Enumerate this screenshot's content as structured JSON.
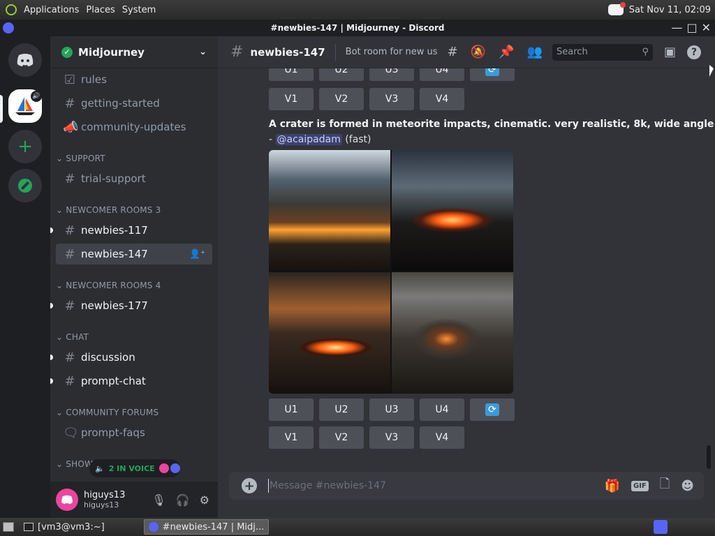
{
  "system_bar": {
    "menus": [
      "Applications",
      "Places",
      "System"
    ],
    "clock": "Sat Nov 11, 02:09"
  },
  "window": {
    "title": "#newbies-147 | Midjourney - Discord"
  },
  "guild": {
    "name": "Midjourney"
  },
  "sidebar": {
    "channels_top": [
      {
        "label": "rules"
      },
      {
        "label": "getting-started"
      },
      {
        "label": "community-updates"
      }
    ],
    "categories": {
      "support": "SUPPORT",
      "newcomer3": "NEWCOMER ROOMS 3",
      "newcomer4": "NEWCOMER ROOMS 4",
      "chat": "CHAT",
      "forums": "COMMUNITY FORUMS",
      "showcase": "SHOWC"
    },
    "channels": {
      "trial_support": "trial-support",
      "newbies_117": "newbies-117",
      "newbies_147": "newbies-147",
      "newbies_177": "newbies-177",
      "discussion": "discussion",
      "prompt_chat": "prompt-chat",
      "prompt_faqs": "prompt-faqs"
    }
  },
  "voice_pill": {
    "label": "2 IN VOICE"
  },
  "user": {
    "display_name": "higuys13",
    "username": "higuys13"
  },
  "channel_header": {
    "name": "newbies-147",
    "topic": "Bot room for new us...",
    "search_placeholder": "Search"
  },
  "message": {
    "prompt": "A crater is formed in meteorite impacts, cinematic. very realistic, 8k, wide angle",
    "dash": "-",
    "mention": "@acaipadam",
    "mode": "(fast)"
  },
  "buttons": {
    "upscale": [
      "U1",
      "U2",
      "U3",
      "U4"
    ],
    "variation": [
      "V1",
      "V2",
      "V3",
      "V4"
    ]
  },
  "composer": {
    "placeholder": "Message #newbies-147",
    "gif_label": "GIF"
  },
  "taskbar": {
    "terminal": "[vm3@vm3:~]",
    "discord": "#newbies-147 | Midj..."
  },
  "colors": {
    "blurple": "#5865f2",
    "green": "#23a55a",
    "mention_bg": "#3c4270",
    "mention_fg": "#c9cdfb"
  }
}
